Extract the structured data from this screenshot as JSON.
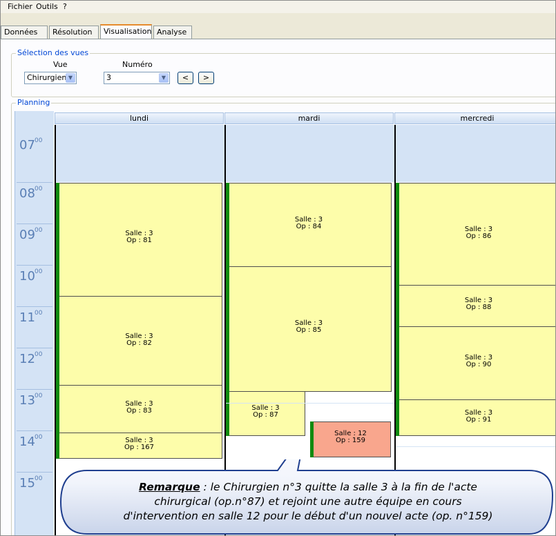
{
  "menu": [
    "Fichier",
    "Outils",
    "?"
  ],
  "tabs": [
    {
      "label": "Données",
      "active": false
    },
    {
      "label": "Résolution",
      "active": false
    },
    {
      "label": "Visualisation",
      "active": true
    },
    {
      "label": "Analyse",
      "active": false
    }
  ],
  "view_selection": {
    "title": "Sélection des vues",
    "vue_label": "Vue",
    "vue_value": "Chirurgien",
    "numero_label": "Numéro",
    "numero_value": "3",
    "prev_label": "<",
    "next_label": ">"
  },
  "planning": {
    "title": "Planning",
    "days": [
      "lundi",
      "mardi",
      "mercredi"
    ],
    "hours": [
      {
        "h": "07",
        "m": "00"
      },
      {
        "h": "08",
        "m": "00"
      },
      {
        "h": "09",
        "m": "00"
      },
      {
        "h": "10",
        "m": "00"
      },
      {
        "h": "11",
        "m": "00"
      },
      {
        "h": "12",
        "m": "00"
      },
      {
        "h": "13",
        "m": "00"
      },
      {
        "h": "14",
        "m": "00"
      },
      {
        "h": "15",
        "m": "00"
      }
    ],
    "appointments": {
      "lundi": [
        {
          "salle": "Salle : 3",
          "op": "Op : 81"
        },
        {
          "salle": "Salle : 3",
          "op": "Op : 82"
        },
        {
          "salle": "Salle : 3",
          "op": "Op : 83"
        },
        {
          "salle": "Salle : 3",
          "op": "Op : 167"
        }
      ],
      "mardi": [
        {
          "salle": "Salle : 3",
          "op": "Op : 84"
        },
        {
          "salle": "Salle : 3",
          "op": "Op : 85"
        },
        {
          "salle": "Salle : 3",
          "op": "Op : 87"
        },
        {
          "salle": "Salle : 12",
          "op": "Op : 159"
        }
      ],
      "mercredi": [
        {
          "salle": "Salle : 3",
          "op": "Op : 86"
        },
        {
          "salle": "Salle : 3",
          "op": "Op : 88"
        },
        {
          "salle": "Salle : 3",
          "op": "Op : 90"
        },
        {
          "salle": "Salle : 3",
          "op": "Op : 91"
        }
      ]
    }
  },
  "remark": {
    "title": "Remarque",
    "line1": " : le Chirurgien n°3 quitte la salle 3 à la fin de l'acte",
    "line2": "chirurgical (op.n°87) et rejoint une autre équipe en cours",
    "line3": "d'intervention en salle 12 pour le début d'un nouvel acte (op. n°159)"
  },
  "colors": {
    "appointment": "#fdfdaa",
    "appointment_other_room": "#f9a68d",
    "status_bar": "#0f8a0f",
    "hour_column": "#d4e3f5",
    "callout_border": "#1f3f8f"
  }
}
